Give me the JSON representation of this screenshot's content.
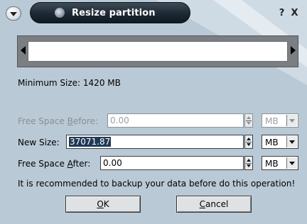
{
  "window": {
    "title": "Resize partition",
    "help_label": "?",
    "close_label": "X"
  },
  "partition": {
    "min_size_text": "Minimum Size: 1420 MB"
  },
  "fields": {
    "before": {
      "label_pre": "Free Space ",
      "label_access": "B",
      "label_post": "efore:",
      "value": "0.00",
      "unit": "MB",
      "enabled": false
    },
    "size": {
      "label_pre": "New Size: ",
      "label_access": "",
      "label_post": "",
      "value": "37071.87",
      "unit": "MB",
      "enabled": true
    },
    "after": {
      "label_pre": "Free Space ",
      "label_access": "A",
      "label_post": "fter:",
      "value": "0.00",
      "unit": "MB",
      "enabled": true
    }
  },
  "warning": "It is recommended to backup your data before do this operation!",
  "buttons": {
    "ok_access": "O",
    "ok_rest": "K",
    "cancel_access": "C",
    "cancel_rest": "ancel"
  },
  "colors": {
    "title_bar": "#1c2833",
    "selection": "#1f3a57",
    "slider_frame": "#7b7f83",
    "dialog_bg": "#b9c9d6"
  }
}
